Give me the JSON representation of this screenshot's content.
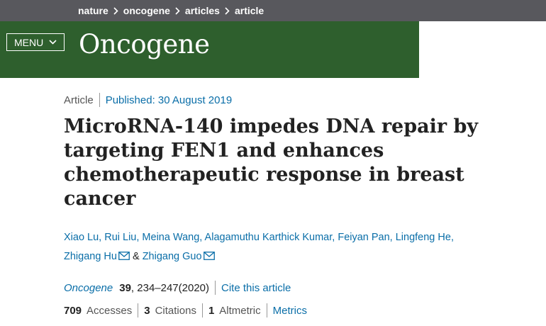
{
  "breadcrumb": {
    "items": [
      "nature",
      "oncogene",
      "articles",
      "article"
    ]
  },
  "header": {
    "menu_label": "MENU",
    "journal": "Oncogene"
  },
  "article": {
    "type": "Article",
    "published": "Published: 30 August 2019",
    "title": "MicroRNA-140 impedes DNA repair by targeting FEN1 and enhances chemotherapeutic response in breast cancer",
    "authors_line1": "Xiao Lu, Rui Liu, Meina Wang, Alagamuthu Karthick Kumar, Feiyan Pan, Lingfeng He,",
    "author_hu": "Zhigang Hu",
    "amp": "&",
    "author_guo": "Zhigang Guo"
  },
  "citation": {
    "journal": "Oncogene",
    "volume": "39",
    "pages": ", 234–247(2020)",
    "cite_link": "Cite this article"
  },
  "metrics": {
    "accesses_count": "709",
    "accesses_label": "Accesses",
    "citations_count": "3",
    "citations_label": "Citations",
    "altmetric_count": "1",
    "altmetric_label": "Altmetric",
    "metrics_link": "Metrics"
  },
  "colors": {
    "breadcrumb_bg": "#58585d",
    "masthead_bg": "#2e5f2d",
    "link": "#0a6ea8"
  }
}
